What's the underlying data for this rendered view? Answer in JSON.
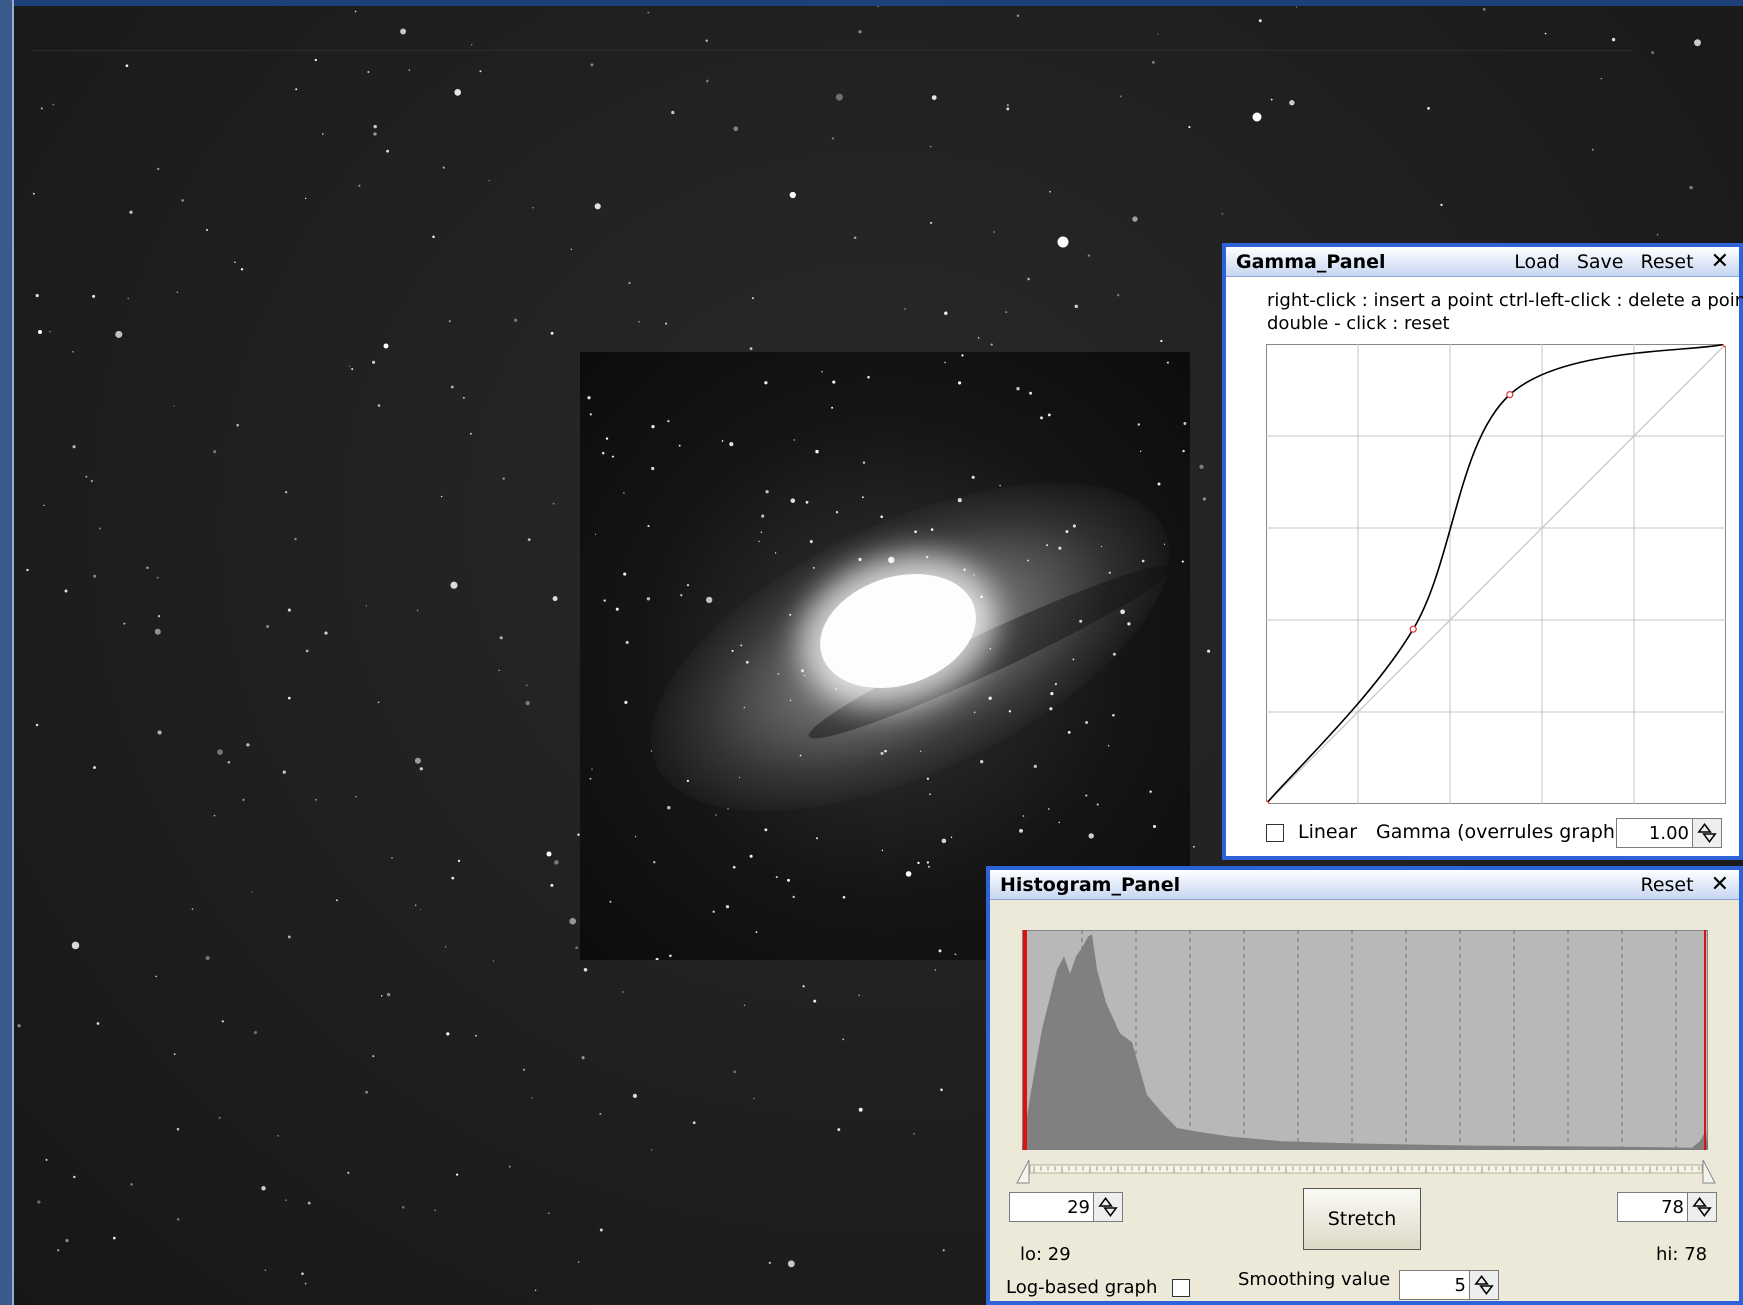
{
  "gamma_panel": {
    "title": "Gamma_Panel",
    "actions": [
      "Load",
      "Save",
      "Reset"
    ],
    "hint_line_1": "right-click : insert a point   ctrl-left-click : delete a point",
    "hint_line_2": "double - click : reset",
    "curve_points": [
      [
        0.0,
        0.0
      ],
      [
        0.32,
        0.38
      ],
      [
        0.53,
        0.89
      ],
      [
        1.0,
        1.0
      ]
    ],
    "linear_label": "Linear",
    "linear_checked": false,
    "gamma_label": "Gamma (overrules graph)",
    "gamma_value": "1.00"
  },
  "histogram_panel": {
    "title": "Histogram_Panel",
    "reset_label": "Reset",
    "lo_value": "29",
    "hi_value": "78",
    "stretch_label": "Stretch",
    "lo_readout": "lo: 29",
    "hi_readout": "hi: 78",
    "log_label": "Log-based graph",
    "log_checked": false,
    "smoothing_label": "Smoothing value",
    "smoothing_value": "5"
  },
  "colors": {
    "panel_border": "#2e62d8",
    "curve_point": "#e03030",
    "histogram_fill": "#808080",
    "histogram_bg": "#b8b8b8",
    "marker_red": "#dd1111"
  },
  "icons": [
    "close-icon",
    "spinner-arrows-icon",
    "checkbox-icon",
    "slider-track-icon"
  ]
}
